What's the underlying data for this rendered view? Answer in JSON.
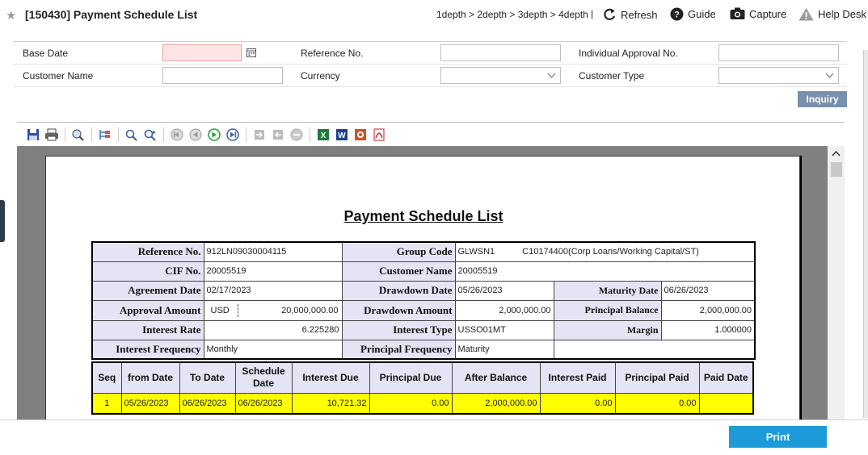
{
  "header": {
    "title": "[150430] Payment Schedule List",
    "breadcrumb": "1depth > 2depth > 3depth > 4depth",
    "separator": "|",
    "refresh": "Refresh",
    "guide": "Guide",
    "capture": "Capture",
    "help_desk": "Help Desk"
  },
  "search": {
    "base_date_label": "Base Date",
    "base_date_value": "",
    "reference_no_label": "Reference No.",
    "reference_no_value": "",
    "individual_approval_label": "Individual Approval No.",
    "individual_approval_value": "",
    "customer_name_label": "Customer Name",
    "customer_name_value": "",
    "currency_label": "Currency",
    "currency_value": "",
    "customer_type_label": "Customer Type",
    "customer_type_value": "",
    "inquiry_label": "Inquiry"
  },
  "toolbar_icons": [
    "save-icon",
    "print-icon",
    "zoom-icon",
    "tree-icon",
    "search-icon",
    "search-next-icon",
    "first-page-icon",
    "prev-page-icon",
    "next-page-icon",
    "last-page-icon",
    "import-icon",
    "export-icon",
    "stop-icon",
    "excel-icon",
    "word-icon",
    "powerpoint-icon",
    "pdf-icon"
  ],
  "report": {
    "title": "Payment Schedule List",
    "info": {
      "reference_no_label": "Reference No.",
      "reference_no": "912LN09030004115",
      "group_code_label": "Group Code",
      "group_code": "GLWSN1",
      "group_code_desc": "C10174400(Corp Loans/Working Capital/ST)",
      "cif_no_label": "CIF No.",
      "cif_no": "20005519",
      "customer_name_label": "Customer Name",
      "customer_name": "20005519",
      "agreement_date_label": "Agreement Date",
      "agreement_date": "02/17/2023",
      "drawdown_date_label": "Drawdown Date",
      "drawdown_date": "05/26/2023",
      "maturity_date_label": "Maturity Date",
      "maturity_date": "06/26/2023",
      "approval_amount_label": "Approval Amount",
      "approval_currency": "USD",
      "approval_amount": "20,000,000.00",
      "drawdown_amount_label": "Drawdown Amount",
      "drawdown_amount": "2,000,000.00",
      "principal_balance_label": "Principal Balance",
      "principal_balance": "2,000,000.00",
      "interest_rate_label": "Interest Rate",
      "interest_rate": "6.225280",
      "interest_type_label": "Interest Type",
      "interest_type": "USSO01MT",
      "margin_label": "Margin",
      "margin": "1.000000",
      "interest_frequency_label": "Interest Frequency",
      "interest_frequency": "Monthly",
      "principal_frequency_label": "Principal Frequency",
      "principal_frequency": "Maturity"
    },
    "schedule_headers": [
      "Seq",
      "from Date",
      "To Date",
      "Schedule Date",
      "Interest Due",
      "Principal Due",
      "After Balance",
      "Interest Paid",
      "Principal Paid",
      "Paid Date"
    ],
    "schedule_rows": [
      [
        "1",
        "05/26/2023",
        "06/26/2023",
        "06/26/2023",
        "10,721.32",
        "0.00",
        "2,000,000.00",
        "0.00",
        "0.00",
        ""
      ]
    ]
  },
  "footer": {
    "print_label": "Print"
  }
}
